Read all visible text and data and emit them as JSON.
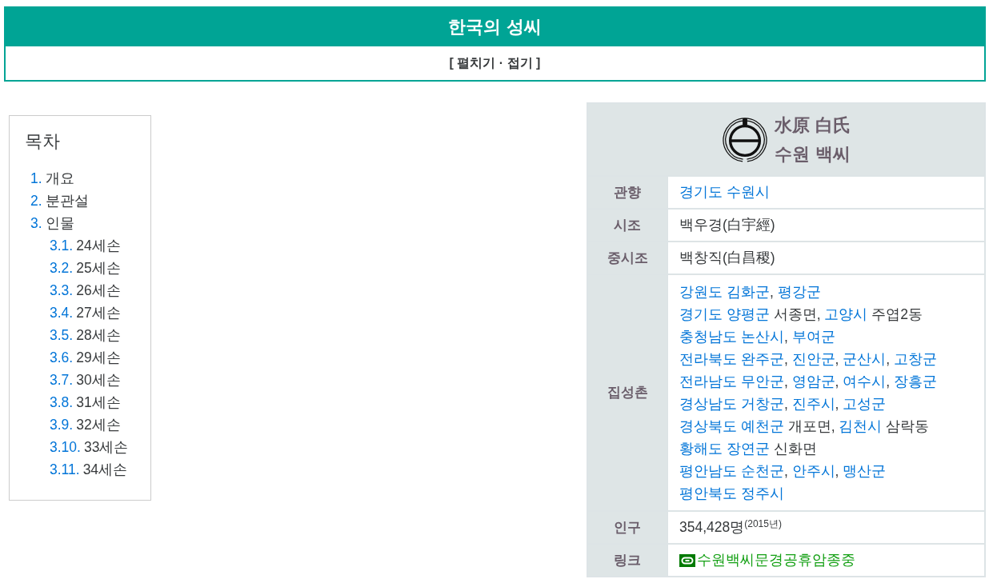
{
  "navbox": {
    "title": "한국의 성씨",
    "toggle": "[ 펼치기 · 접기 ]"
  },
  "toc": {
    "title": "목차",
    "items": [
      {
        "number": "1.",
        "label": "개요"
      },
      {
        "number": "2.",
        "label": "분관설"
      },
      {
        "number": "3.",
        "label": "인물",
        "children": [
          {
            "number": "3.1.",
            "label": "24세손"
          },
          {
            "number": "3.2.",
            "label": "25세손"
          },
          {
            "number": "3.3.",
            "label": "26세손"
          },
          {
            "number": "3.4.",
            "label": "27세손"
          },
          {
            "number": "3.5.",
            "label": "28세손"
          },
          {
            "number": "3.6.",
            "label": "29세손"
          },
          {
            "number": "3.7.",
            "label": "30세손"
          },
          {
            "number": "3.8.",
            "label": "31세손"
          },
          {
            "number": "3.9.",
            "label": "32세손"
          },
          {
            "number": "3.10.",
            "label": "33세손"
          },
          {
            "number": "3.11.",
            "label": "34세손"
          }
        ]
      }
    ]
  },
  "infobox": {
    "title_hanja": "水原 白氏",
    "title_hangul": "수원 백씨",
    "rows": [
      {
        "label": "관향",
        "kind": "lines",
        "lines": [
          [
            {
              "kind": "link",
              "text": "경기도 수원시"
            }
          ]
        ]
      },
      {
        "label": "시조",
        "kind": "lines",
        "lines": [
          [
            {
              "kind": "text",
              "text": "백우경(白宇經)"
            }
          ]
        ]
      },
      {
        "label": "중시조",
        "kind": "lines",
        "lines": [
          [
            {
              "kind": "text",
              "text": "백창직(白昌稷)"
            }
          ]
        ]
      },
      {
        "label": "집성촌",
        "kind": "lines",
        "lines": [
          [
            {
              "kind": "link",
              "text": "강원도 김화군",
              "suffix": ", "
            },
            {
              "kind": "link",
              "text": "평강군"
            }
          ],
          [
            {
              "kind": "link",
              "text": "경기도 양평군",
              "suffix": " 서종면, "
            },
            {
              "kind": "link",
              "text": "고양시",
              "suffix": " 주엽2동"
            }
          ],
          [
            {
              "kind": "link",
              "text": "충청남도 논산시",
              "suffix": ", "
            },
            {
              "kind": "link",
              "text": "부여군"
            }
          ],
          [
            {
              "kind": "link",
              "text": "전라북도 완주군",
              "suffix": ", "
            },
            {
              "kind": "link",
              "text": "진안군",
              "suffix": ", "
            },
            {
              "kind": "link",
              "text": "군산시",
              "suffix": ", "
            },
            {
              "kind": "link",
              "text": "고창군"
            }
          ],
          [
            {
              "kind": "link",
              "text": "전라남도 무안군",
              "suffix": ", "
            },
            {
              "kind": "link",
              "text": "영암군",
              "suffix": ", "
            },
            {
              "kind": "link",
              "text": "여수시",
              "suffix": ", "
            },
            {
              "kind": "link",
              "text": "장흥군"
            }
          ],
          [
            {
              "kind": "link",
              "text": "경상남도 거창군",
              "suffix": ", "
            },
            {
              "kind": "link",
              "text": "진주시",
              "suffix": ", "
            },
            {
              "kind": "link",
              "text": "고성군"
            }
          ],
          [
            {
              "kind": "link",
              "text": "경상북도 예천군",
              "suffix": " 개포면, "
            },
            {
              "kind": "link",
              "text": "김천시",
              "suffix": " 삼락동"
            }
          ],
          [
            {
              "kind": "link",
              "text": "황해도 장연군",
              "suffix": " 신화면"
            }
          ],
          [
            {
              "kind": "link",
              "text": "평안남도 순천군",
              "suffix": ", "
            },
            {
              "kind": "link",
              "text": "안주시",
              "suffix": ", "
            },
            {
              "kind": "link",
              "text": "맹산군"
            }
          ],
          [
            {
              "kind": "link",
              "text": "평안북도 정주시"
            }
          ]
        ]
      },
      {
        "label": "인구",
        "kind": "lines",
        "lines": [
          [
            {
              "kind": "text",
              "text": "354,428명$^{(2015년)}$"
            }
          ]
        ]
      },
      {
        "label": "링크",
        "kind": "external",
        "text": "수원백씨문경공휴암종중"
      }
    ]
  }
}
